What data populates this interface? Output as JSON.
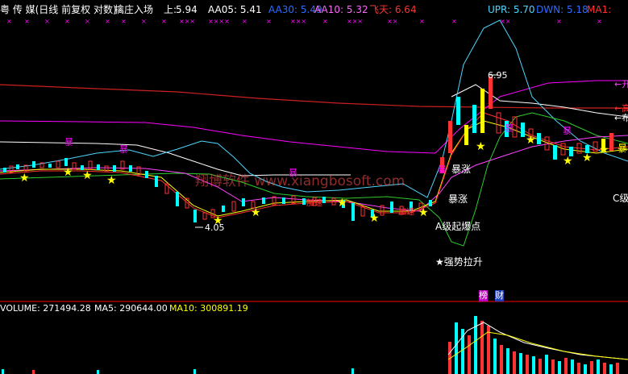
{
  "header": {
    "title": "粤 传 媒(日线 前复权 对数)",
    "indicator": "擒庄入场",
    "shang_label": "上:",
    "shang_value": "5.94",
    "aa05": "AA05: 5.41",
    "aa30": "AA30: 5.49",
    "aa10": "AA10: 5.32",
    "feitian": "飞天: 6.64",
    "upr": "UPR: 5.70",
    "dwn": "DWN: 5.18",
    "ma1": "MA1:"
  },
  "colors": {
    "background": "#000000",
    "up": "#ff3333",
    "down": "#00ffff",
    "yellow": "#ffff00",
    "magenta": "#ff00ff",
    "white": "#ffffff",
    "green": "#00cc00",
    "cyan_line": "#4fd6ff",
    "red_line": "#ff4040",
    "pink": "#ff66ff"
  },
  "price_labels": {
    "high": "6.95",
    "low": "4.05"
  },
  "annotations": {
    "baozhang1": "暴涨",
    "baozhang2": "暴涨",
    "aji": "A级起爆点",
    "qiangshi": "★强势拉升",
    "cji": "C级",
    "jiasu1": "加速",
    "jiasu2": "加速",
    "bao": "暴",
    "bang": "榜",
    "cai": "财",
    "watermark": "翔博软件 www.xiangbosoft.com",
    "edge_arrow": "暴"
  },
  "right_edge": {
    "marks": [
      "←开",
      "←高",
      "←布"
    ]
  },
  "volume": {
    "volume": "VOLUME: 271494.28",
    "ma5": "MA5: 290644.00",
    "ma10": "MA10: 300891.19"
  },
  "chart_data": {
    "type": "candlestick",
    "price_high_label": 6.95,
    "price_low_label": 4.05,
    "volume": 271494.28,
    "volume_ma5": 290644.0,
    "volume_ma10": 300891.19
  }
}
